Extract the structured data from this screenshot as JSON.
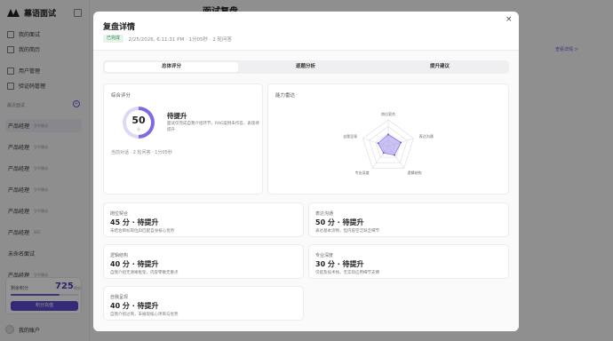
{
  "app": {
    "brand": "幕语面试",
    "nav": [
      "我的面试",
      "我的简历",
      "用户管理",
      "验证码管理"
    ],
    "section_label": "最近面试",
    "history": [
      {
        "title": "产品经理",
        "tag": "字节跳动"
      },
      {
        "title": "产品经理",
        "tag": "字节跳动"
      },
      {
        "title": "产品经理",
        "tag": "字节跳动"
      },
      {
        "title": "产品经理",
        "tag": "字节跳动"
      },
      {
        "title": "产品经理",
        "tag": "字节跳动"
      },
      {
        "title": "产品经理",
        "tag": "SEE"
      },
      {
        "title": "未命名面试",
        "tag": ""
      },
      {
        "title": "产品经理",
        "tag": "字节跳动"
      }
    ],
    "credit": {
      "label": "剩余积分",
      "value": "725",
      "unit": "积分",
      "fill": 0.72,
      "button": "积分充值"
    },
    "account": "我的账户",
    "background_title": "面试复盘",
    "background_link": "查看详情 >"
  },
  "modal": {
    "title": "复盘详情",
    "close": "×",
    "status_badge": "已完成",
    "meta": "· 2/25/2026, 6:11:31 PM · 1分05秒 · 2 轮问答",
    "tabs": [
      "总体评分",
      "逐题分析",
      "提升建议"
    ],
    "overall": {
      "label": "综合评分",
      "score": "50",
      "score_unit": "分",
      "level": "待提升",
      "desc": "面试仅完成自我介绍环节，RAG案例未作答，表现待提升",
      "footer": "当前对话 · 2 轮问答 · 1分05秒"
    },
    "radar": {
      "label": "能力雷达",
      "axes": [
        "岗位契合",
        "表达沟通",
        "逻辑结构",
        "专业深度",
        "自我呈现"
      ],
      "values": [
        45,
        50,
        40,
        30,
        40
      ],
      "max": 100,
      "fill_color": "#8b7be8"
    },
    "dimensions": [
      {
        "name": "岗位契合",
        "score": "45 分 · 待提升",
        "desc": "未结合目标岗位JD匹配自身核心优势"
      },
      {
        "name": "表达沟通",
        "score": "50 分 · 待提升",
        "desc": "表达基本流畅，但内容空泛缺乏细节"
      },
      {
        "name": "逻辑结构",
        "score": "40 分 · 待提升",
        "desc": "自我介绍无清晰框架，内容零散无重点"
      },
      {
        "name": "专业深度",
        "score": "30 分 · 待提升",
        "desc": "仅提及技术栈，无实际应用细节支撑"
      },
      {
        "name": "自我呈现",
        "score": "40 分 · 待提升",
        "desc": "自我介绍过简，未展现核心项目与优势"
      }
    ]
  }
}
